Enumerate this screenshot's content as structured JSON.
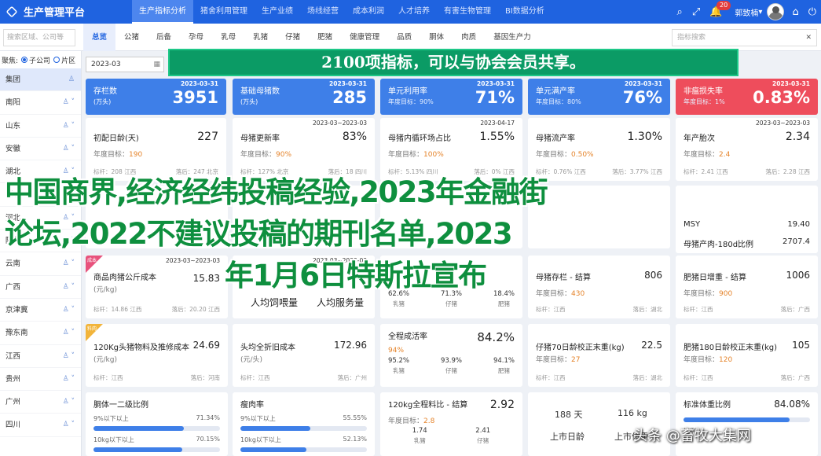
{
  "app": {
    "title": "生产管理平台"
  },
  "nav": {
    "tabs": [
      "生产指标分析",
      "猪舍利用管理",
      "生产业绩",
      "场线经营",
      "成本利润",
      "人才培养",
      "有害生物管理",
      "BI数据分析"
    ],
    "active": 0
  },
  "topbar": {
    "badge": "20",
    "user_name": "郭致楠"
  },
  "subbar": {
    "region_placeholder": "搜索区域、公司等",
    "tabs": [
      "总览",
      "公猪",
      "后备",
      "孕母",
      "乳母",
      "乳猪",
      "仔猪",
      "肥猪",
      "健康管理",
      "品质",
      "胴体",
      "肉质",
      "基因生产力"
    ],
    "active": 0,
    "indicator_placeholder": "指标搜索"
  },
  "sidebar": {
    "head": "聚焦:",
    "opt1": "子公司",
    "opt2": "片区",
    "items": [
      "集团",
      "南阳",
      "山东",
      "安徽",
      "湖北",
      "辽宁",
      "河北",
      "陕北",
      "云南",
      "广西",
      "京津冀",
      "豫东南",
      "江西",
      "贵州",
      "广州",
      "四川"
    ]
  },
  "date": "2023-03",
  "banner": "2100项指标，可以与协会会员共享。",
  "top_cards": [
    {
      "title": "存栏数",
      "unit": "(万头)",
      "date": "2023-03-31",
      "value": "3951",
      "target": "",
      "color": "blue"
    },
    {
      "title": "基础母猪数",
      "unit": "(万头)",
      "date": "2023-03-31",
      "value": "285",
      "target": "",
      "color": "blue"
    },
    {
      "title": "单元利用率",
      "unit": "",
      "date": "2023-03-31",
      "value": "71%",
      "target": "年度目标：90%",
      "color": "blue"
    },
    {
      "title": "单元满产率",
      "unit": "",
      "date": "2023-03-31",
      "value": "76%",
      "target": "年度目标：80%",
      "color": "blue"
    },
    {
      "title": "非瘟损失率",
      "unit": "",
      "date": "2023-03-31",
      "value": "0.83%",
      "target": "年度目标：1%",
      "color": "red"
    }
  ],
  "row2": [
    {
      "title": "初配日龄",
      "unit": "(天)",
      "date": "",
      "value": "227",
      "target_label": "年度目标：",
      "target": "190",
      "f1": "标杆：208 江西",
      "f2": "落后：247 北京"
    },
    {
      "title": "母猪更新率",
      "unit": "",
      "date": "2023-03~2023-03",
      "value": "83%",
      "target_label": "年度目标：",
      "target": "90%",
      "f1": "标杆：127% 北京",
      "f2": "落后：18 四川"
    },
    {
      "title": "母猪内循环场占比",
      "unit": "",
      "date": "2023-04-17",
      "value": "1.55%",
      "target_label": "年度目标：",
      "target": "100%",
      "f1": "标杆：5.13% 四川",
      "f2": "落后：0% 江西"
    },
    {
      "title": "母猪流产率",
      "unit": "",
      "date": "",
      "value": "1.30%",
      "target_label": "年度目标：",
      "target": "0.50%",
      "f1": "标杆：0.76% 江西",
      "f2": "落后：3.77% 江西"
    },
    {
      "title": "年产胎次",
      "unit": "",
      "date": "2023-03~2023-03",
      "value": "2.34",
      "target_label": "年度目标：",
      "target": "2.4",
      "f1": "标杆：2.41 江西",
      "f2": "落后：2.28 江西"
    }
  ],
  "mid_labels": {
    "a": "人均饲喂量",
    "b": "人均服务量"
  },
  "row4": {
    "c1": {
      "badge": "成本",
      "date": "2023-03~2023-03",
      "title": "商品肉猪公斤成本",
      "unit": "(元/kg)",
      "value": "15.83",
      "f1": "标杆：14.86 江西",
      "f2": "落后：20.20 江西"
    },
    "c2": {
      "date": "2023-03~2023-03",
      "title": "",
      "value": ""
    },
    "c3": {
      "v1": "62.6%",
      "l1": "乳猪",
      "v2": "71.3%",
      "l2": "仔猪",
      "v3": "18.4%",
      "l3": "肥猪"
    },
    "c4": {
      "title": "母猪存栏 - 结算",
      "target_label": "年度目标：",
      "target": "430",
      "value": "806",
      "f1": "标杆：江西",
      "f2": "落后：湖北"
    },
    "c5": {
      "title": "肥猪日增重 - 结算",
      "target_label": "年度目标：",
      "target": "900",
      "value": "1006",
      "f1": "标杆：江西",
      "f2": "落后：广西"
    },
    "c6": {
      "rows": [
        {
          "label": "MSY",
          "value": "19.40"
        },
        {
          "label": "母猪产肉-180d比例",
          "value": "2707.4"
        }
      ],
      "extra_label": "",
      "extra_value": ""
    }
  },
  "row5": [
    {
      "badge": "料肉",
      "title": "120Kg头猪物料及推修成本",
      "unit": "(元/kg)",
      "value": "24.69",
      "f1": "标杆：江西",
      "f2": "落后：河南"
    },
    {
      "title": "头均全折旧成本",
      "unit": "(元/头)",
      "value": "172.96",
      "f1": "标杆：江西",
      "f2": "落后：广州"
    },
    {
      "title": "全程成活率",
      "target": "94%",
      "value": "84.2%",
      "g": [
        {
          "v": "95.2%",
          "l": "乳猪"
        },
        {
          "v": "93.9%",
          "l": "仔猪"
        },
        {
          "v": "94.1%",
          "l": "肥猪"
        }
      ]
    },
    {
      "title": "仔猪70日龄校正末重",
      "unit": "(kg)",
      "target_label": "年度目标：",
      "target": "27",
      "value": "22.5",
      "f1": "标杆：江西",
      "f2": "落后：湖北"
    },
    {
      "title": "肥猪180日龄校正末重",
      "unit": "(kg)",
      "target_label": "年度目标：",
      "target": "120",
      "value": "105",
      "f1": "标杆：江西",
      "f2": "落后：广西"
    }
  ],
  "row6": [
    {
      "title": "胴体一二级比例",
      "l1": "9%以下以上",
      "p1": "71.34%",
      "v1": 71.34,
      "l2": "10kg以下以上",
      "p2": "70.15%",
      "v2": 70.15
    },
    {
      "title": "瘦肉率",
      "l1": "9%以下以上",
      "p1": "55.55%",
      "v1": 55.55,
      "l2": "10kg以下以上",
      "p2": "52.13%",
      "v2": 52.13
    },
    {
      "title": "120kg全程料比 - 结算",
      "value": "2.92",
      "target_label": "年度目标：",
      "target": "2.8",
      "b1": "1.74",
      "bl1": "乳猪",
      "b2": "2.41",
      "bl2": "仔猪"
    },
    {
      "a": "188 天",
      "b": "116 kg",
      "c": "上市日龄",
      "d": "上市体重"
    },
    {
      "title": "标准体重比例",
      "value": "84.08%",
      "v": 84.08,
      "l1": "比例",
      "p1": "",
      "l2": "",
      "p2": ""
    }
  ],
  "overlay": {
    "line1": "中国商界,经济经纬投稿经验,2023年金融街",
    "line2": "论坛,2022不建议投稿的期刊名单,2023",
    "line3": "年1月6日特斯拉宣布"
  },
  "watermark": "头条 @畜牧大集网",
  "colors": {
    "topbar": "#1f63e0",
    "card_blue": "#3e7fe8",
    "card_red": "#ee4d5c",
    "banner": "#0b9b65",
    "overlay": "#0e8f3e",
    "accent_orange": "#e5842b"
  }
}
